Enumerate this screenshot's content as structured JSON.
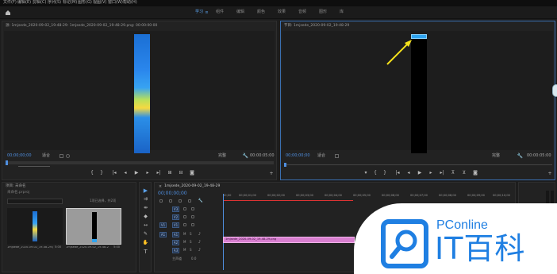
{
  "menu": {
    "items": [
      "文件(F)",
      "编辑(E)",
      "剪辑(C)",
      "序列(S)",
      "标记(M)",
      "图形(G)",
      "视图(V)",
      "窗口(W)",
      "帮助(H)"
    ]
  },
  "workspace": {
    "tabs": [
      "学习",
      "组件",
      "编辑",
      "颜色",
      "效果",
      "音频",
      "图形",
      "库"
    ],
    "active_index": 0
  },
  "source_monitor": {
    "title": "源: 1mjsede_2020-09-02_19-48-29: 1mjsede_2020-09-02_19-48-29.png: 00:00:00:00",
    "timecode_in": "00;00;00;00",
    "fit_label": "适合",
    "zoom_label": "完整",
    "timecode_out": "00:00:05:00"
  },
  "program_monitor": {
    "title": "节目: 1mjsede_2020-09-02_19-48-29",
    "timecode_in": "00;00;00;00",
    "fit_label": "适合",
    "zoom_label": "完整",
    "timecode_out": "00:00:05:00"
  },
  "project_panel": {
    "title": "项目: 未命名",
    "subtitle": "未命名.prproj",
    "search_placeholder": "",
    "selection_info": "1项已选择，共2项",
    "items": [
      {
        "name": "1mjsede_2020-09-02_19-48-29.png",
        "duration": "5:00"
      },
      {
        "name": "1mjsede_2020-09-02_19-48-29",
        "duration": "5:00"
      }
    ]
  },
  "timeline": {
    "title": "1mjsede_2020-09-02_19-48-29",
    "timecode": "00;00;00;00",
    "ruler": [
      "00;00",
      "00;00;01;00",
      "00;00;02;00",
      "00;00;03;00",
      "00;00;04;00",
      "00;00;05;00",
      "00;00;06;00",
      "00;00;07;00",
      "00;00;08;00",
      "00;00;09;00",
      "00;00;10;00"
    ],
    "tracks": [
      "V3",
      "V2",
      "V1",
      "A1",
      "A2",
      "A3"
    ],
    "source_patch": [
      "V1",
      "A1"
    ],
    "master_label": "主声道",
    "master_value": "0.0",
    "clip_label": "1mjsede_2020-09-02_19-48-29.png"
  },
  "watermark": {
    "brand": "PConline",
    "tagline": "IT百科"
  },
  "colors": {
    "accent_blue": "#4f8fe0",
    "clip_pink": "#d87fd0",
    "arrow_yellow": "#f4e11c",
    "logo_blue": "#1f7fe2"
  }
}
